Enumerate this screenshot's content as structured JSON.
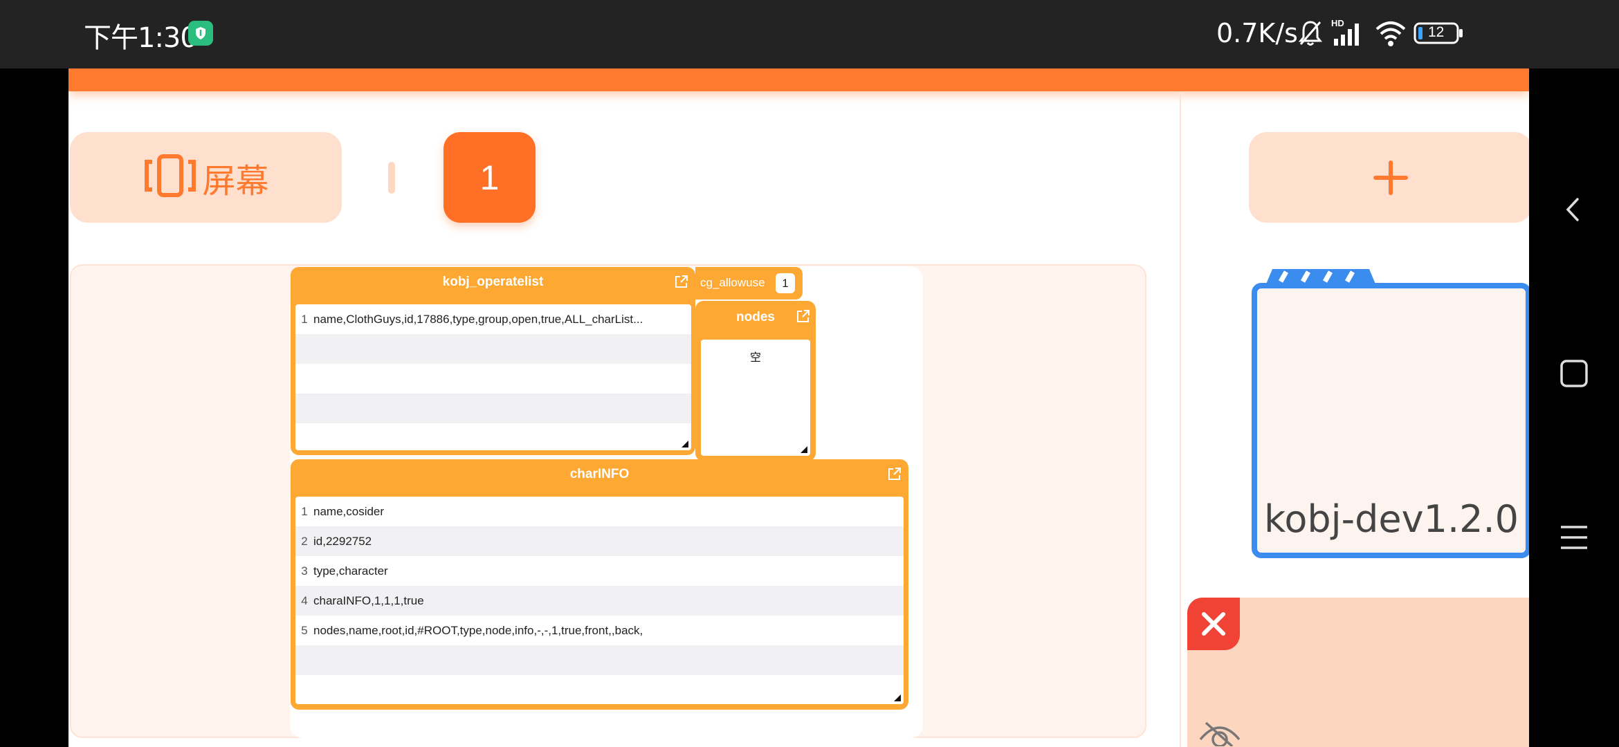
{
  "status_bar": {
    "time": "下午1:30",
    "net_speed": "0.7K/s",
    "battery": "12",
    "signal_label": "HD",
    "icons": [
      "shield-icon",
      "mute-bell-icon",
      "signal-icon",
      "wifi-icon",
      "battery-icon"
    ]
  },
  "toolbar": {
    "screen_label": "屏幕",
    "active_tab": "1",
    "add_label": "+"
  },
  "panels": {
    "operatelist": {
      "title": "kobj_operatelist",
      "rows": [
        {
          "num": "1",
          "text": "name,ClothGuys,id,17886,type,group,open,true,ALL_charList..."
        }
      ]
    },
    "cg_allowuse": {
      "label": "cg_allowuse",
      "value": "1"
    },
    "nodes": {
      "title": "nodes",
      "empty_text": "空"
    },
    "charinfo": {
      "title": "charINFO",
      "rows": [
        {
          "num": "1",
          "text": "name,cosider"
        },
        {
          "num": "2",
          "text": "id,2292752"
        },
        {
          "num": "3",
          "text": "type,character"
        },
        {
          "num": "4",
          "text": "charaINFO,1,1,1,true"
        },
        {
          "num": "5",
          "text": "nodes,name,root,id,#ROOT,type,node,info,-,-,1,true,front,,back,"
        }
      ]
    }
  },
  "folder": {
    "name": "kobj-dev1.2.0"
  },
  "colors": {
    "accent": "#ff7a2e",
    "panel": "#fda833",
    "folder_border": "#3b8cef",
    "close": "#f04336"
  }
}
